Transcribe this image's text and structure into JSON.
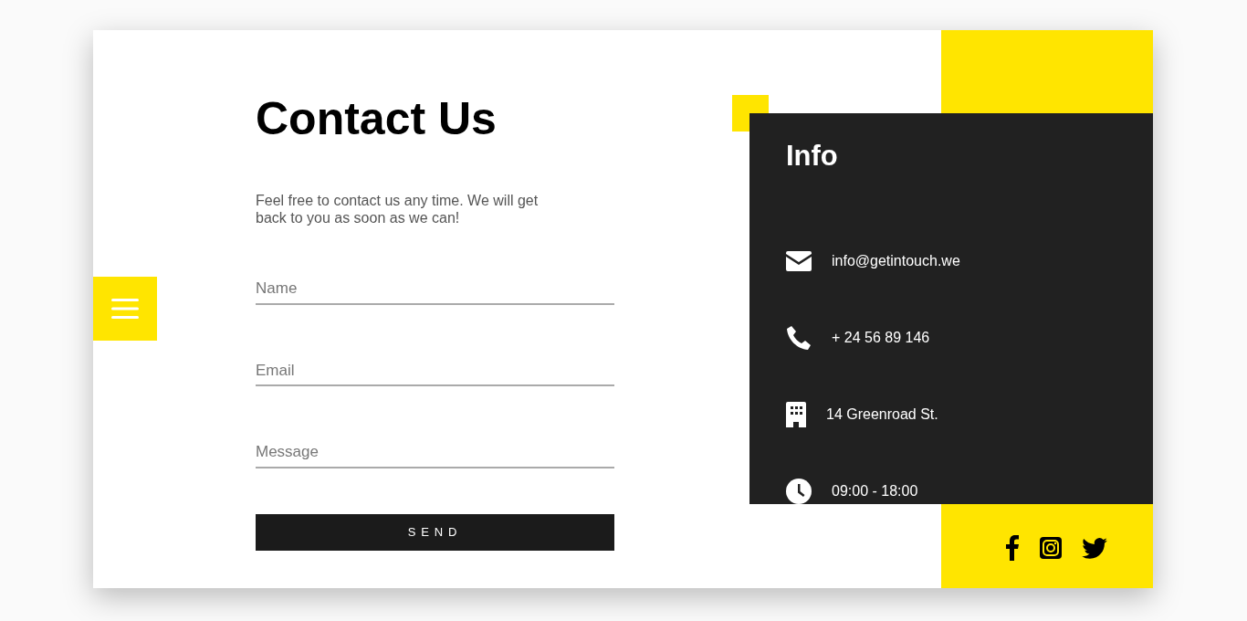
{
  "form": {
    "title": "Contact Us",
    "intro": "Feel free to contact us any time. We will get back to you as soon as we can!",
    "fields": [
      {
        "placeholder": "Name"
      },
      {
        "placeholder": "Email"
      },
      {
        "placeholder": "Message"
      }
    ],
    "button": "SEND"
  },
  "info": {
    "title": "Info",
    "items": [
      {
        "kind": "email",
        "text": "info@getintouch.we"
      },
      {
        "kind": "phone",
        "text": "+ 24 56 89 146"
      },
      {
        "kind": "address",
        "text": "14 Greenroad St."
      },
      {
        "kind": "hours",
        "text": "09:00 - 18:00"
      }
    ]
  },
  "social": [
    {
      "kind": "facebook"
    },
    {
      "kind": "instagram"
    },
    {
      "kind": "twitter"
    }
  ]
}
